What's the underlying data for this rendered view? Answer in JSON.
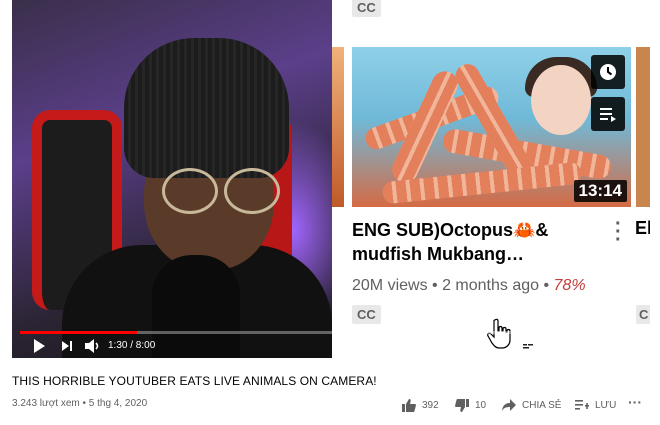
{
  "endscreen": {
    "cc_top": "CC",
    "video": {
      "title": "ENG SUB)Octopus🦀& mudfish Mukbang…",
      "duration": "13:14",
      "views": "20M views",
      "age": "2 months ago",
      "rating": "78%",
      "cc": "CC"
    },
    "next_title": "El",
    "next_cc": "C"
  },
  "player": {
    "time": "1:30 / 8:00",
    "progress": 0.1875,
    "colors": {
      "progress": "#ff0000"
    }
  },
  "video_title": "THIS HORRIBLE YOUTUBER EATS LIVE ANIMALS ON CAMERA!",
  "views_line": "3.243 lượt xem • 5 thg 4, 2020",
  "actions": {
    "likes": "392",
    "dislikes": "10",
    "share": "CHIA SẺ",
    "save": "LƯU"
  },
  "icons": [
    "play-icon",
    "next-icon",
    "volume-icon",
    "subtitles-icon",
    "settings-icon",
    "miniplayer-icon",
    "theater-icon",
    "fullscreen-icon",
    "clock-icon",
    "queue-icon",
    "like-icon",
    "dislike-icon",
    "share-icon",
    "save-icon",
    "more-icon"
  ]
}
